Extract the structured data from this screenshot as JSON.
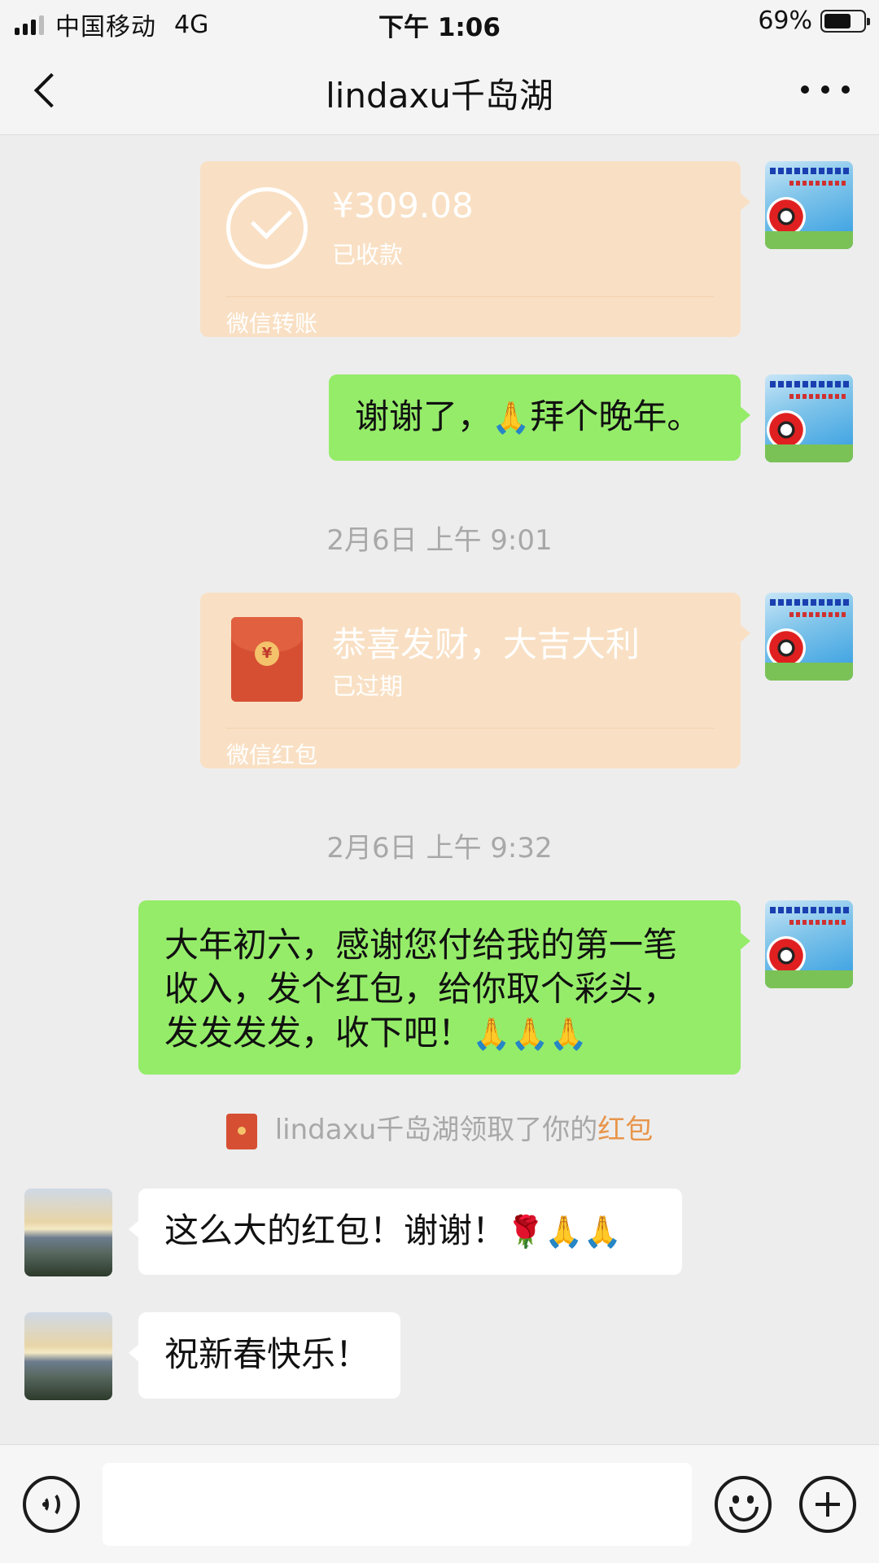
{
  "status_bar": {
    "carrier": "中国移动",
    "network": "4G",
    "time": "下午 1:06",
    "battery_percent": "69%",
    "battery_level": 0.69
  },
  "nav": {
    "title": "lindaxu千岛湖",
    "back_icon": "chevron-left-icon",
    "more_icon": "more-dots-icon"
  },
  "messages": {
    "transfer": {
      "amount": "¥309.08",
      "status": "已收款",
      "footer": "微信转账"
    },
    "thanks": {
      "text_before": "谢谢了，",
      "emoji": "🙏",
      "text_after": "拜个晚年。"
    },
    "timestamp1": "2月6日 上午 9:01",
    "redpacket": {
      "title": "恭喜发财，大吉大利",
      "status": "已过期",
      "footer": "微信红包",
      "coin_symbol": "¥"
    },
    "timestamp2": "2月6日 上午 9:32",
    "long_message": {
      "line1": "大年初六，感谢您付给我的第一笔",
      "line2": "收入，发个红包，给你取个彩头，",
      "line3": "发发发发，收下吧！",
      "emojis": "🙏🙏🙏"
    },
    "system_notice": {
      "text": "lindaxu千岛湖领取了你的",
      "link": "红包"
    },
    "reply1": {
      "text": "这么大的红包！谢谢！",
      "emojis": "🌹🙏🙏"
    },
    "reply2": {
      "text": "祝新春快乐！"
    }
  },
  "input_bar": {
    "voice_icon": "voice-icon",
    "emoji_icon": "emoji-icon",
    "plus_icon": "plus-icon",
    "input_value": ""
  },
  "colors": {
    "chat_bg": "#ededed",
    "sent_bubble": "#95ec69",
    "received_bubble": "#ffffff",
    "payment_card": "#f9e0c4",
    "link_orange": "#e8954b"
  }
}
